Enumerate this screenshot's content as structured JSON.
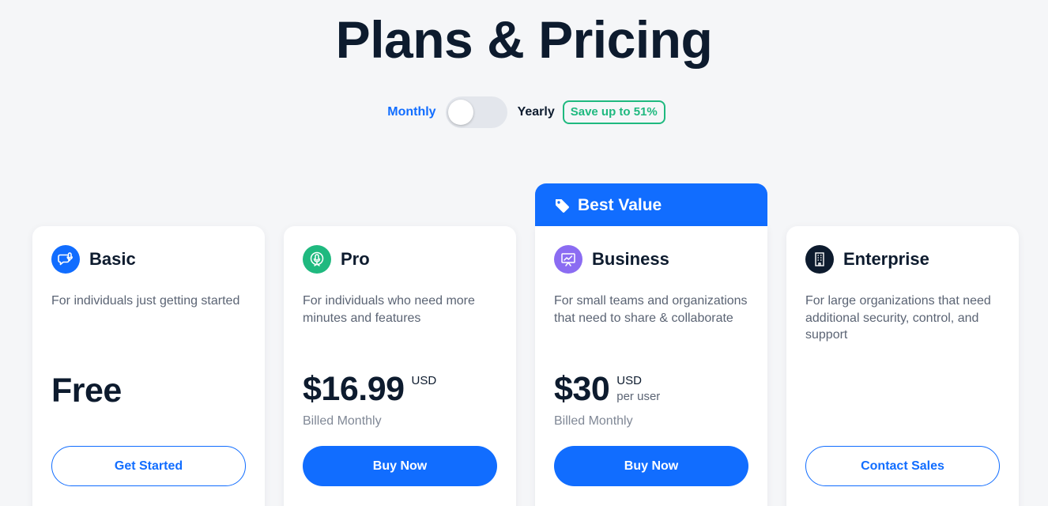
{
  "page": {
    "title": "Plans & Pricing"
  },
  "billing": {
    "monthly_label": "Monthly",
    "yearly_label": "Yearly",
    "save_badge": "Save up to 51%",
    "selected": "Monthly"
  },
  "colors": {
    "accent": "#116dff",
    "save_green": "#1fb97f",
    "basic_icon": "#116dff",
    "pro_icon": "#1fb97f",
    "business_icon": "#8b6cf2",
    "enterprise_icon": "#0d1b2e"
  },
  "plans": [
    {
      "name": "Basic",
      "icon": "chat-bubble-mic-icon",
      "description": "For individuals just getting started",
      "price": "Free",
      "currency": "",
      "unit": "",
      "billed": "",
      "cta": "Get Started"
    },
    {
      "name": "Pro",
      "icon": "microphone-icon",
      "description": "For individuals who need more minutes and features",
      "price": "$16.99",
      "currency": "USD",
      "unit": "",
      "billed": "Billed Monthly",
      "cta": "Buy Now"
    },
    {
      "name": "Business",
      "icon": "presentation-chart-icon",
      "banner": "Best Value",
      "banner_icon": "tag-icon",
      "description": "For small teams and organizations that need to share & collaborate",
      "price": "$30",
      "currency": "USD",
      "unit": "per user",
      "billed": "Billed Monthly",
      "cta": "Buy Now"
    },
    {
      "name": "Enterprise",
      "icon": "building-icon",
      "description": "For large organizations that need additional security, control, and support",
      "price": "",
      "currency": "",
      "unit": "",
      "billed": "",
      "cta": "Contact Sales"
    }
  ]
}
